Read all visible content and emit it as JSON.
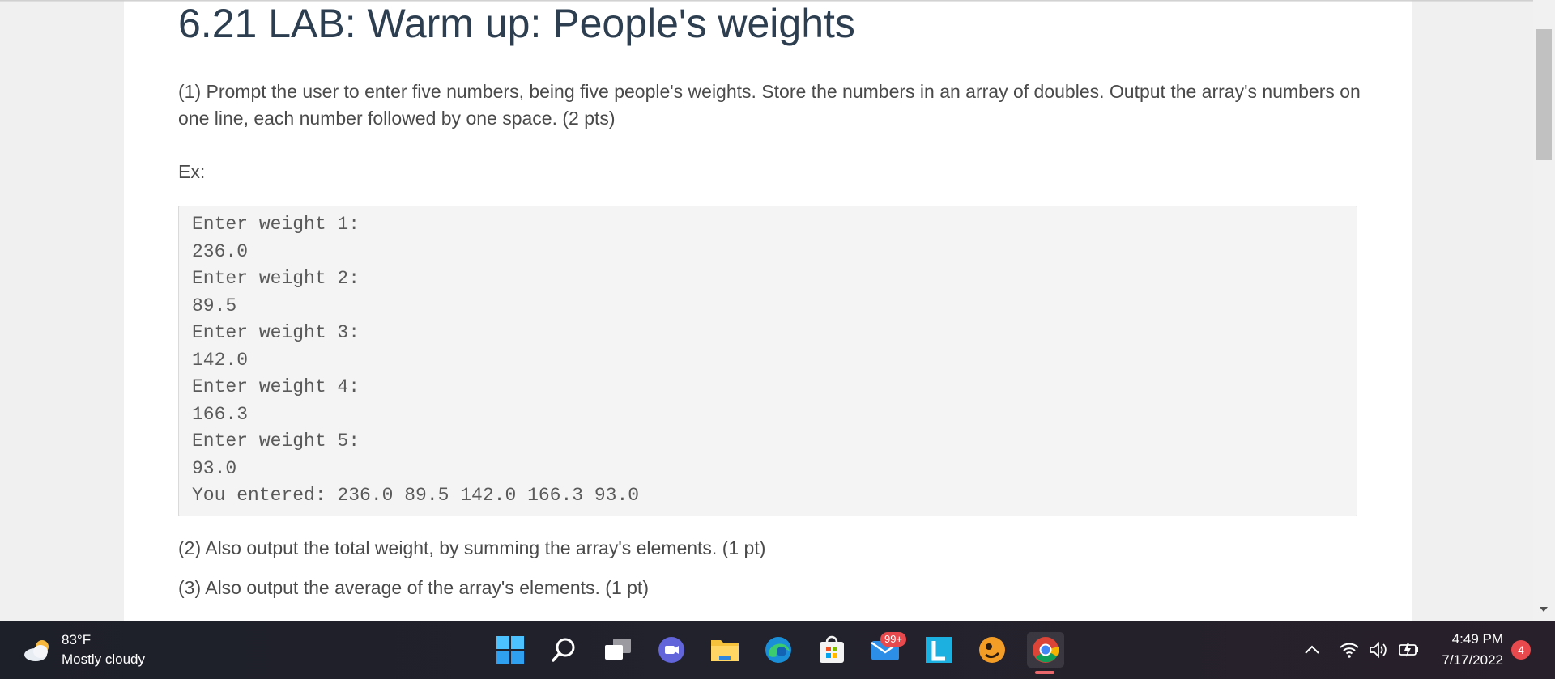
{
  "lab": {
    "title": "6.21 LAB: Warm up: People's weights",
    "para1": "(1) Prompt the user to enter five numbers, being five people's weights. Store the numbers in an array of doubles. Output the array's numbers on one line, each number followed by one space. (2 pts)",
    "ex_label": "Ex:",
    "example_lines": [
      "Enter weight 1:",
      "236.0",
      "Enter weight 2:",
      "89.5",
      "Enter weight 3:",
      "142.0",
      "Enter weight 4:",
      "166.3",
      "Enter weight 5:",
      "93.0",
      "You entered: 236.0 89.5 142.0 166.3 93.0"
    ],
    "para2": "(2) Also output the total weight, by summing the array's elements. (1 pt)",
    "para3": "(3) Also output the average of the array's elements. (1 pt)"
  },
  "taskbar": {
    "weather_temp": "83°F",
    "weather_desc": "Mostly cloudy",
    "mail_badge": "99+",
    "clock_time": "4:49 PM",
    "clock_date": "7/17/2022",
    "notification_count": "4",
    "icons": [
      "start-icon",
      "search-icon",
      "task-view-icon",
      "chat-icon",
      "file-explorer-icon",
      "edge-icon",
      "store-icon",
      "mail-icon",
      "l-app-icon",
      "game-app-icon",
      "chrome-icon"
    ]
  },
  "colors": {
    "title": "#2c3e50",
    "code_bg": "#f4f4f4",
    "badge": "#e8494d"
  }
}
